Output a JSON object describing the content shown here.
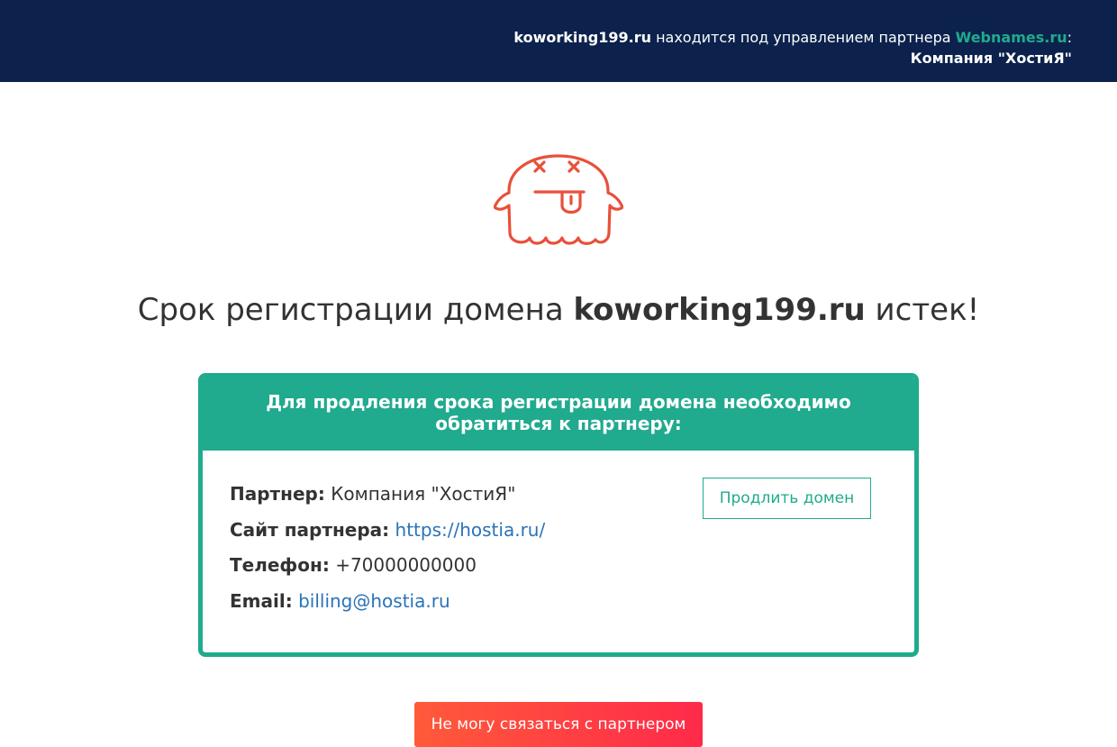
{
  "topbar": {
    "domain": "koworking199.ru",
    "text": " находится под управлением партнера ",
    "partner_link": "Webnames.ru",
    "colon": ":",
    "company": "Компания \"ХостиЯ\""
  },
  "icon": {
    "name": "dead-ghost-icon",
    "color": "#e8503a"
  },
  "headline": {
    "before": "Срок регистрации домена ",
    "domain": "koworking199.ru",
    "after": " истек!"
  },
  "card": {
    "header": "Для продления срока регистрации домена необходимо обратиться к партнеру:",
    "partner_label": "Партнер:",
    "partner_value": "Компания \"ХостиЯ\"",
    "site_label": "Сайт партнера:",
    "site_value": "https://hostia.ru/",
    "phone_label": "Телефон:",
    "phone_value": "+70000000000",
    "email_label": "Email:",
    "email_value": "billing@hostia.ru",
    "extend_button": "Продлить домен"
  },
  "bottom_button": "Не могу связаться с партнером",
  "colors": {
    "navy": "#0c224c",
    "teal": "#20aa8e",
    "link": "#2a73b8",
    "accent_red": "#ff2a4a"
  }
}
